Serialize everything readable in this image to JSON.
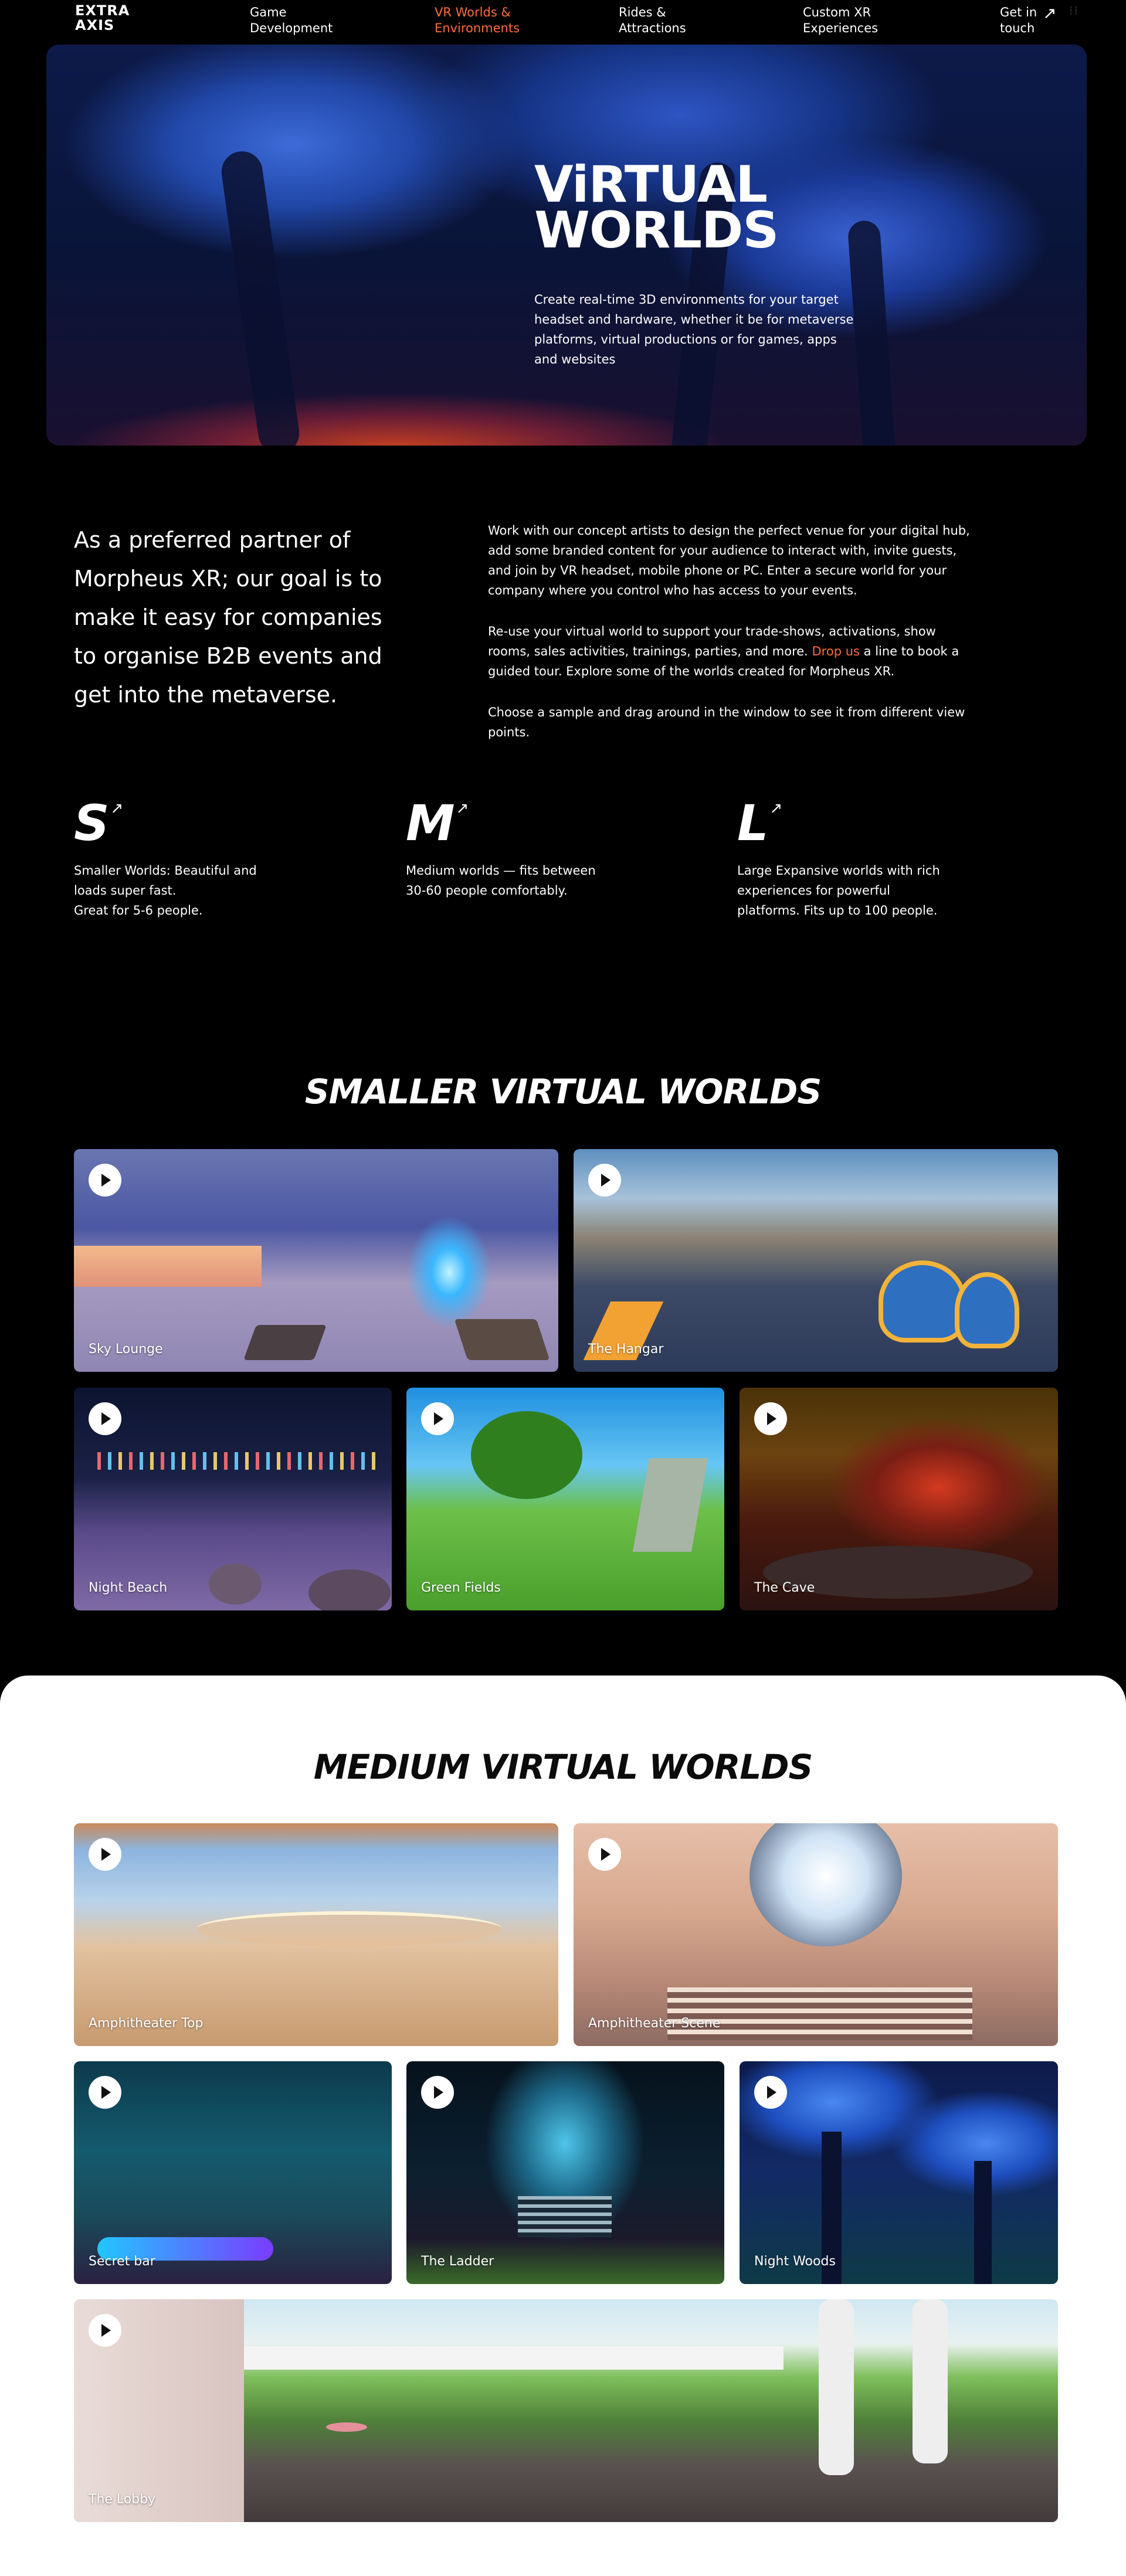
{
  "nav": {
    "logo_line1": "EXTRA",
    "logo_line2": "AXIS",
    "items": [
      {
        "label_l1": "Game",
        "label_l2": "Development"
      },
      {
        "label_l1": "VR Worlds &",
        "label_l2": "Environments"
      },
      {
        "label_l1": "Rides &",
        "label_l2": "Attractions"
      },
      {
        "label_l1": "Custom XR",
        "label_l2": "Experiences"
      }
    ],
    "cta_l1": "Get in",
    "cta_l2": "touch",
    "arrow_icon": "arrow-up-right-icon",
    "active_color": "#ff6b3d"
  },
  "hero": {
    "title_l1": "ViRTUAL",
    "title_l2": "WORLDS",
    "text": "Create real-time 3D environments for your target headset and hardware, whether it be for metaverse platforms, virtual productions or for games, apps and websites"
  },
  "intro": {
    "lead": "As a preferred partner of Morpheus XR; our goal is to make it easy for companies to organise B2B events and get into the metaverse.",
    "p1": "Work with our concept artists to design the perfect venue for your digital hub, add some branded content for your audience to interact with, invite guests, and join by VR headset, mobile phone or PC. Enter a secure world for your company where you control who has access to your events.",
    "p2_before": "Re-use your virtual world to support your trade-shows, activations, show rooms, sales activities, trainings, parties, and more. ",
    "p2_link": "Drop us",
    "p2_after": " a line to book a guided tour. Explore some of the worlds created for Morpheus XR.",
    "p3": "Choose a sample and drag around in the window to see it from different view points."
  },
  "sizes": [
    {
      "letter": "S",
      "line1": "Smaller Worlds: Beautiful and",
      "line2": "loads super fast.",
      "line3": "Great for 5-6 people."
    },
    {
      "letter": "M",
      "line1": "Medium worlds — fits between",
      "line2": "30-60 people comfortably.",
      "line3": ""
    },
    {
      "letter": "L",
      "line1": "Large Expansive worlds with rich",
      "line2": "experiences for powerful",
      "line3": "platforms. Fits up to 100 people."
    }
  ],
  "smaller": {
    "title": "SMALLER VIRTUAL WORLDS",
    "cards": [
      {
        "label": "Sky Lounge"
      },
      {
        "label": "The Hangar"
      },
      {
        "label": "Night Beach"
      },
      {
        "label": "Green Fields"
      },
      {
        "label": "The Cave"
      }
    ]
  },
  "medium": {
    "title": "MEDIUM VIRTUAL WORLDS",
    "cards": [
      {
        "label": "Amphitheater Top"
      },
      {
        "label": "Amphitheater Scene"
      },
      {
        "label": "Secret bar"
      },
      {
        "label": "The Ladder"
      },
      {
        "label": "Night Woods"
      },
      {
        "label": "The Lobby"
      }
    ]
  }
}
